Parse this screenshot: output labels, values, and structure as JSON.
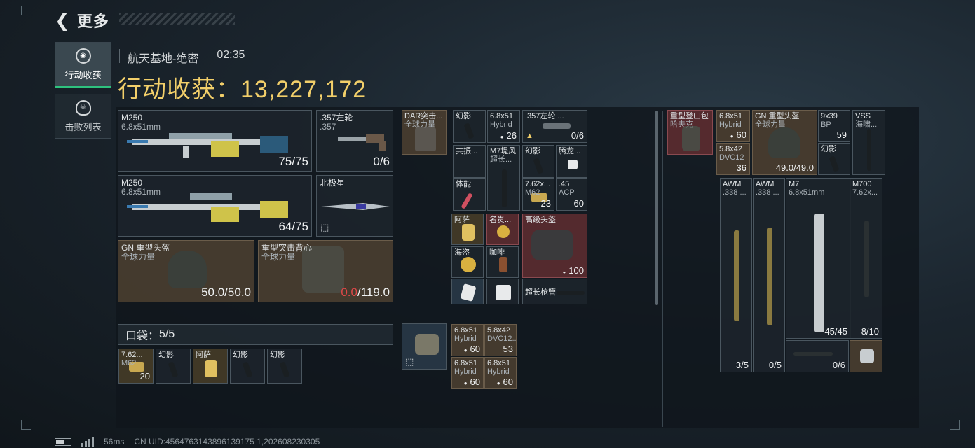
{
  "header": {
    "title": "更多",
    "back_icon": "back-arrow-icon"
  },
  "sidebar": [
    {
      "label": "行动收获",
      "icon": "loot-icon",
      "active": true
    },
    {
      "label": "击败列表",
      "icon": "skull-icon",
      "active": false
    }
  ],
  "match": {
    "map": "航天基地-绝密",
    "time": "02:35"
  },
  "gain": {
    "label": "行动收获：",
    "value": "13,227,172"
  },
  "equip": {
    "primary1": {
      "name": "M250",
      "caliber": "6.8x51mm",
      "ammo": "75/75"
    },
    "secondary": {
      "name": ".357左轮",
      "caliber": ".357",
      "ammo": "0/6"
    },
    "primary2": {
      "name": "M250",
      "caliber": "6.8x51mm",
      "ammo": "64/75"
    },
    "melee": {
      "name": "北极星"
    },
    "helmet": {
      "name": "GN 重型头盔",
      "sub": "全球力量",
      "dur": "50.0/50.0"
    },
    "armor": {
      "name": "重型突击背心",
      "sub": "全球力量",
      "dur_cur": "0.0",
      "dur_max": "/119.0"
    }
  },
  "pocket": {
    "label": "口袋：",
    "count": "5/5",
    "items": [
      {
        "name": "7.62...",
        "sub": "M62",
        "count": "20"
      },
      {
        "name": "幻影"
      },
      {
        "name": "阿萨"
      },
      {
        "name": "幻影"
      },
      {
        "name": "幻影"
      }
    ]
  },
  "chest": {
    "rig": {
      "name": "DAR突击...",
      "sub": "全球力量"
    },
    "items": [
      {
        "name": "幻影"
      },
      {
        "name": "6.8x51",
        "sub": "Hybrid",
        "count": "26"
      },
      {
        "name": ".357左轮 ...",
        "count": "0/6"
      },
      {
        "name": "共振..."
      },
      {
        "name": "M7堤风",
        "sub": "超长..."
      },
      {
        "name": "幻影"
      },
      {
        "name": "腾龙..."
      },
      {
        "name": "体能"
      },
      {
        "name": "7.62x...",
        "sub": "M62",
        "count": "23"
      },
      {
        "name": ".45",
        "sub": "ACP",
        "count": "60"
      }
    ]
  },
  "bag_items": [
    {
      "name": "阿萨"
    },
    {
      "name": "名贵..."
    },
    {
      "name": "海盗"
    },
    {
      "name": "咖啡"
    },
    {
      "name": "高级头盔",
      "count": "100"
    },
    {
      "name": "超长枪管"
    }
  ],
  "lower_items": [
    {
      "name": "6.8x51",
      "sub": "Hybrid",
      "count": "60"
    },
    {
      "name": "5.8x42",
      "sub": "DVC12...",
      "count": "53"
    },
    {
      "name": "6.8x51",
      "sub": "Hybrid",
      "count": "60"
    },
    {
      "name": "6.8x51",
      "sub": "Hybrid",
      "count": "60"
    }
  ],
  "backpack": {
    "name": "重型登山包",
    "sub": "哈夫克"
  },
  "right_items": [
    {
      "name": "6.8x51",
      "sub": "Hybrid",
      "count": "60"
    },
    {
      "name": "5.8x42",
      "sub": "DVC12",
      "count": "36"
    },
    {
      "name": "GN 重型头盔",
      "sub": "全球力量",
      "count": "49.0/49.0"
    },
    {
      "name": "9x39",
      "sub": "BP",
      "count": "59"
    },
    {
      "name": "幻影"
    },
    {
      "name": "VSS",
      "sub": "海啸..."
    }
  ],
  "rifles": [
    {
      "name": "AWM",
      "sub": ".338 ...",
      "count": "3/5"
    },
    {
      "name": "AWM",
      "sub": ".338 ...",
      "count": "0/5"
    },
    {
      "name": "M7",
      "sub": "6.8x51mm",
      "count": "45/45"
    },
    {
      "name": "M700",
      "sub": "7.62x...",
      "count": "8/10"
    },
    {
      "count": "0/6"
    }
  ],
  "footer": {
    "ping": "56ms",
    "uid": "CN UID:4564763143896139175 1,202608230305"
  },
  "colors": {
    "gold": "#f2cf6a",
    "accent": "#2ec27e",
    "damage": "#e04848"
  }
}
